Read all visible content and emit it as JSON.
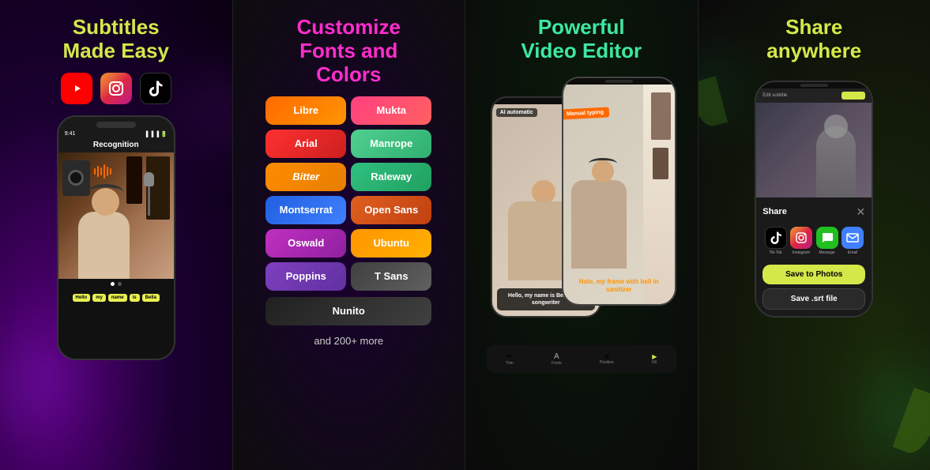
{
  "panels": [
    {
      "id": "panel-1",
      "title_line1": "Subtitles",
      "title_line2": "Made Easy",
      "title_color": "yellow",
      "platforms": [
        "YouTube",
        "Instagram",
        "TikTok"
      ],
      "phone": {
        "time": "9:41",
        "signal": "●●●",
        "screen_label": "Recognition",
        "subtitle_words": [
          "Hello",
          "my",
          "name",
          "is",
          "Bella"
        ]
      }
    },
    {
      "id": "panel-2",
      "title_line1": "Customize",
      "title_line2": "Fonts and",
      "title_line3": "Colors",
      "title_color": "magenta",
      "fonts": [
        "Libre",
        "Mukta",
        "Arial",
        "Manrope",
        "Bitter",
        "Raleway",
        "Montserrat",
        "Open Sans",
        "Oswald",
        "Ubuntu",
        "Poppins",
        "T Sans",
        "Nunito"
      ],
      "subtitle": "and 200+ more"
    },
    {
      "id": "panel-3",
      "title_line1": "Powerful",
      "title_line2": "Video Editor",
      "title_color": "green",
      "phone_back": {
        "label": "AI automatic",
        "subtitle": "Hello, my name is Bella, im a songwriter"
      },
      "phone_front": {
        "label": "Manual typing",
        "subtitle": "Halo, my frame with bell in sanitizer"
      }
    },
    {
      "id": "panel-4",
      "title_line1": "Share",
      "title_line2": "anywhere",
      "title_color": "yellow",
      "share": {
        "title": "Share",
        "apps": [
          {
            "name": "Tik-Tok",
            "icon": "♪"
          },
          {
            "name": "Instagram",
            "icon": "◎"
          },
          {
            "name": "Message",
            "icon": "💬"
          },
          {
            "name": "Email",
            "icon": "✉"
          }
        ],
        "btn1": "Save to Photos",
        "btn2": "Save .srt file"
      }
    }
  ]
}
